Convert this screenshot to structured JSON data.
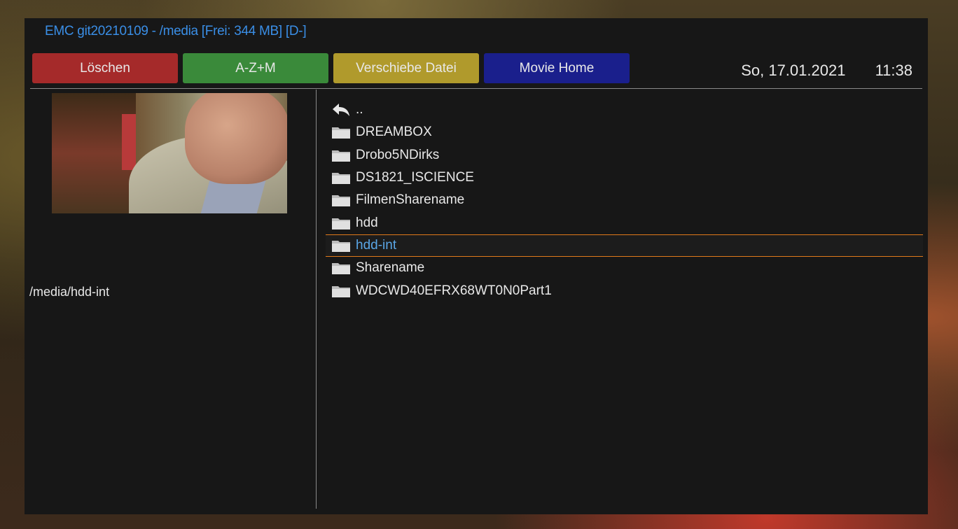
{
  "header": {
    "title": "EMC git20210109 - /media [Frei: 344 MB] [D-]"
  },
  "buttons": {
    "red": "Löschen",
    "green": "A-Z+M",
    "yellow": "Verschiebe Datei",
    "blue": "Movie Home"
  },
  "datetime": {
    "date": "So, 17.01.2021",
    "time": "11:38"
  },
  "left_panel": {
    "current_path": "/media/hdd-int"
  },
  "file_list": {
    "items": [
      {
        "label": "..",
        "icon": "back-arrow-icon"
      },
      {
        "label": "DREAMBOX",
        "icon": "folder-icon"
      },
      {
        "label": "Drobo5NDirks",
        "icon": "folder-icon"
      },
      {
        "label": "DS1821_ISCIENCE",
        "icon": "folder-icon"
      },
      {
        "label": "FilmenSharename",
        "icon": "folder-icon"
      },
      {
        "label": "hdd",
        "icon": "folder-icon"
      },
      {
        "label": "hdd-int",
        "icon": "folder-icon",
        "selected": true
      },
      {
        "label": "Sharename",
        "icon": "folder-icon"
      },
      {
        "label": "WDCWD40EFRX68WT0N0Part1",
        "icon": "folder-icon"
      }
    ]
  },
  "colors": {
    "title": "#3a8ee6",
    "selected_text": "#5aa6e6",
    "selection_border": "#e07a1a",
    "button_red": "#a52a2a",
    "button_green": "#3a8a3a",
    "button_yellow": "#b09a2c",
    "button_blue": "#1a1f8c"
  }
}
